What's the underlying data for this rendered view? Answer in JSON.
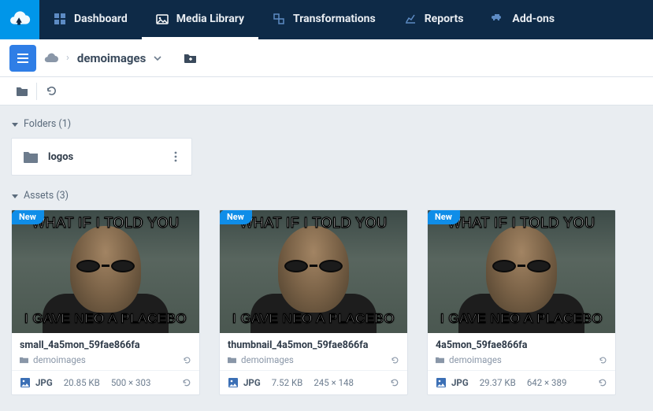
{
  "nav": {
    "dashboard": "Dashboard",
    "media_library": "Media Library",
    "transformations": "Transformations",
    "reports": "Reports",
    "addons": "Add-ons"
  },
  "breadcrumb": {
    "current": "demoimages"
  },
  "sections": {
    "folders_label": "Folders (1)",
    "assets_label": "Assets (3)"
  },
  "folders": [
    {
      "name": "logos"
    }
  ],
  "meme": {
    "top": "WHAT IF I TOLD YOU",
    "bottom": "I GAVE NEO A PLACEBO"
  },
  "badge_new": "New",
  "assets": [
    {
      "title": "small_4a5mon_59fae866fa",
      "folder": "demoimages",
      "format": "JPG",
      "size": "20.85 KB",
      "dims": "500 × 303"
    },
    {
      "title": "thumbnail_4a5mon_59fae866fa",
      "folder": "demoimages",
      "format": "JPG",
      "size": "7.52 KB",
      "dims": "245 × 148"
    },
    {
      "title": "4a5mon_59fae866fa",
      "folder": "demoimages",
      "format": "JPG",
      "size": "29.37 KB",
      "dims": "642 × 389"
    }
  ]
}
